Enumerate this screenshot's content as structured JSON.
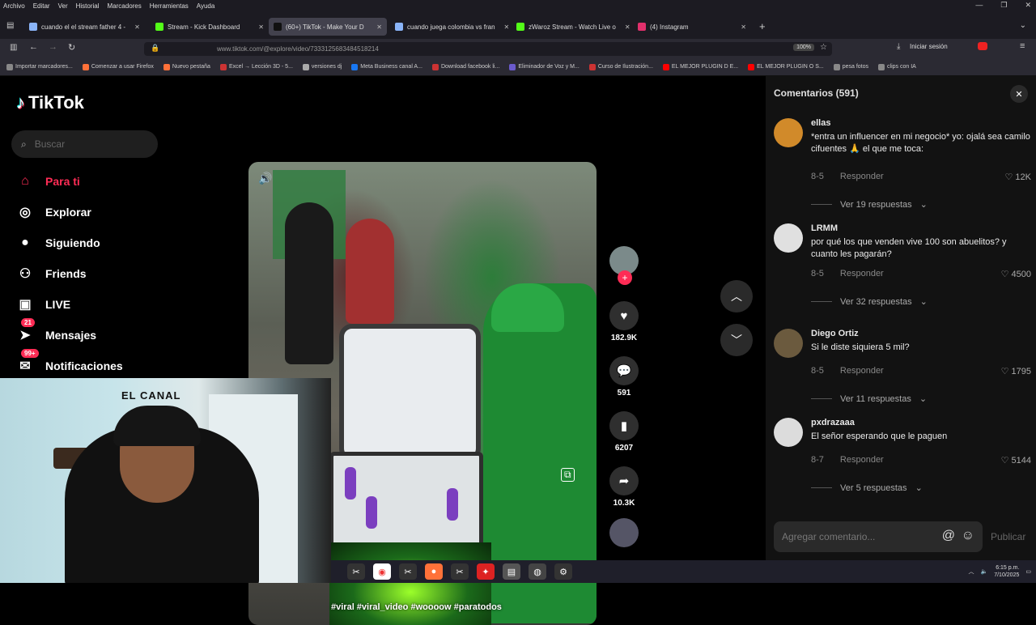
{
  "menubar": [
    "Archivo",
    "Editar",
    "Ver",
    "Historial",
    "Marcadores",
    "Herramientas",
    "Ayuda"
  ],
  "tabs": [
    {
      "label": "cuando el el stream father 4 -",
      "color": "#8ab4f8",
      "active": false
    },
    {
      "label": "Stream - Kick Dashboard",
      "color": "#53fc18",
      "active": false
    },
    {
      "label": "(60+) TikTok - Make Your D",
      "color": "#111111",
      "active": true
    },
    {
      "label": "cuando juega colombia vs fran",
      "color": "#8ab4f8",
      "active": false
    },
    {
      "label": "zWaroz Stream - Watch Live o",
      "color": "#53fc18",
      "active": false
    },
    {
      "label": "(4) Instagram",
      "color": "#e1306c",
      "active": false
    }
  ],
  "url": "www.tiktok.com/@explore/video/7333125683484518214",
  "zoom": "100%",
  "signin": "Iniciar sesión",
  "bookmarks": [
    {
      "label": "Importar marcadores...",
      "color": "#888"
    },
    {
      "label": "Comenzar a usar Firefox",
      "color": "#ff7139"
    },
    {
      "label": "Nuevo pestaña",
      "color": "#ff7139"
    },
    {
      "label": "Excel → Lección 3D - 5...",
      "color": "#c33"
    },
    {
      "label": "versiones dj",
      "color": "#aaa"
    },
    {
      "label": "Meta Business canal A...",
      "color": "#1877f2"
    },
    {
      "label": "Download facebook li...",
      "color": "#c33"
    },
    {
      "label": "Eliminador de Voz y M...",
      "color": "#6a5acd"
    },
    {
      "label": "Curso de Ilustración...",
      "color": "#c33"
    },
    {
      "label": "EL MEJOR PLUGIN D E...",
      "color": "#f00"
    },
    {
      "label": "EL MEJOR PLUGIN O S...",
      "color": "#f00"
    },
    {
      "label": "pesa fotos",
      "color": "#888"
    },
    {
      "label": "clips con IA",
      "color": "#888"
    }
  ],
  "tiktok": {
    "logo": "TikTok",
    "search_placeholder": "Buscar",
    "nav": [
      {
        "label": "Para ti",
        "icon": "home-icon",
        "glyph": "⌂",
        "active": true
      },
      {
        "label": "Explorar",
        "icon": "compass-icon",
        "glyph": "◎",
        "active": false
      },
      {
        "label": "Siguiendo",
        "icon": "following-avatar-icon",
        "glyph": "●",
        "active": false
      },
      {
        "label": "Friends",
        "icon": "friends-icon",
        "glyph": "⚇",
        "active": false
      },
      {
        "label": "LIVE",
        "icon": "live-icon",
        "glyph": "▣",
        "active": false
      },
      {
        "label": "Mensajes",
        "icon": "messages-icon",
        "glyph": "➤",
        "active": false,
        "badge": "21"
      },
      {
        "label": "Notificaciones",
        "icon": "bell-icon",
        "glyph": "✉",
        "active": false,
        "badge": "99+"
      }
    ]
  },
  "video": {
    "hashtags": "#viral #viral_video #woooow #paratodos",
    "likes": "182.9K",
    "comments": "591",
    "saves": "6207",
    "shares": "10.3K"
  },
  "comments_panel": {
    "title": "Comentarios (591)",
    "input_placeholder": "Agregar comentario...",
    "publish": "Publicar",
    "items": [
      {
        "user": "ellas",
        "text": "*entra un influencer en mi negocio* yo: ojalá sea camilo cifuentes 🙏 el que me toca:",
        "date": "8-5",
        "reply": "Responder",
        "likes": "12K",
        "replies": "Ver 19 respuestas",
        "avatar": "#d18a2a"
      },
      {
        "user": "LRMM",
        "text": "por qué los que venden vive 100 son abuelitos? y cuanto les pagarán?",
        "date": "8-5",
        "reply": "Responder",
        "likes": "4500",
        "replies": "Ver 32 respuestas",
        "avatar": "#e0e0e0"
      },
      {
        "user": "Diego Ortiz",
        "text": "Si le diste siquiera 5 mil?",
        "date": "8-5",
        "reply": "Responder",
        "likes": "1795",
        "replies": "Ver 11 respuestas",
        "avatar": "#6b5a3e"
      },
      {
        "user": "pxdrazaaa",
        "text": "El señor esperando que le paguen",
        "date": "8-7",
        "reply": "Responder",
        "likes": "5144",
        "replies": "Ver 5 respuestas",
        "avatar": "#dcdcdc"
      }
    ]
  },
  "webcam": {
    "sign": "EL CANAL"
  },
  "taskbar": {
    "time": "6:15 p.m.",
    "date": "7/10/2025"
  }
}
